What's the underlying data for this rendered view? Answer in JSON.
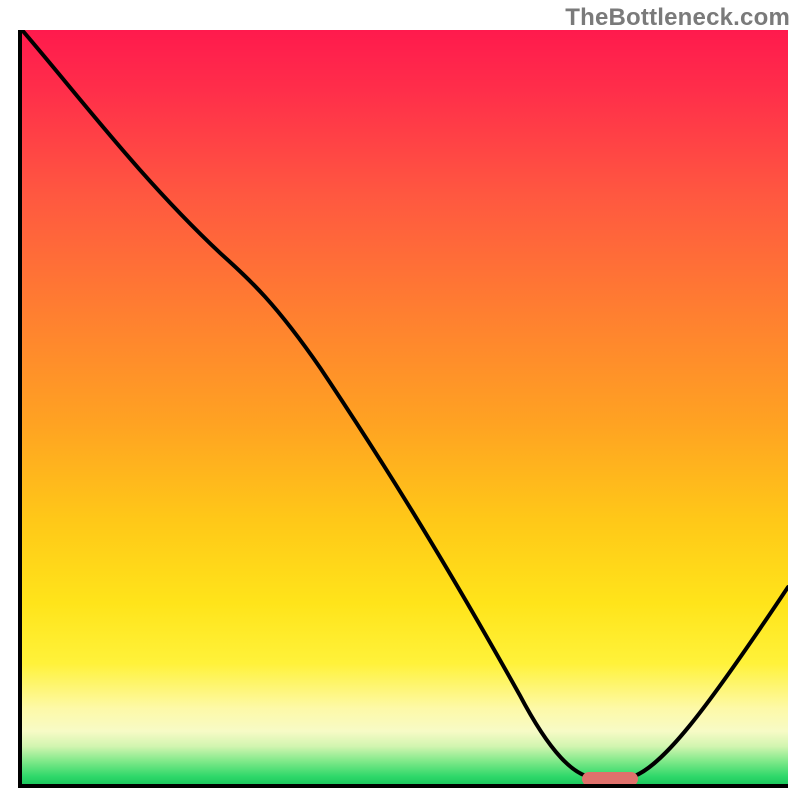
{
  "watermark": "TheBottleneck.com",
  "colors": {
    "axis": "#000000",
    "curve": "#000000",
    "marker": "#e0716c",
    "watermark_text": "#7a7a7a"
  },
  "chart_data": {
    "type": "line",
    "title": "",
    "xlabel": "",
    "ylabel": "",
    "xlim": [
      0,
      100
    ],
    "ylim": [
      0,
      100
    ],
    "grid": false,
    "axes_visible": {
      "left": true,
      "bottom": true,
      "top": false,
      "right": false
    },
    "tick_labels": {
      "x": [],
      "y": []
    },
    "background_gradient_stops": [
      {
        "pct": 0,
        "color": "#ff1a4d"
      },
      {
        "pct": 22,
        "color": "#ff5840"
      },
      {
        "pct": 52,
        "color": "#ffa222"
      },
      {
        "pct": 76,
        "color": "#ffe41a"
      },
      {
        "pct": 93,
        "color": "#f7fbc6"
      },
      {
        "pct": 100,
        "color": "#1cc95e"
      }
    ],
    "series": [
      {
        "name": "curve",
        "x": [
          0,
          10,
          20,
          27,
          40,
          55,
          68,
          73,
          78,
          82,
          90,
          100
        ],
        "y": [
          100,
          88,
          76,
          70,
          50,
          28,
          6,
          1,
          0.5,
          1,
          12,
          27
        ]
      }
    ],
    "marker": {
      "name": "highlight-segment",
      "x_start": 73,
      "x_end": 80,
      "y": 0.7
    }
  }
}
